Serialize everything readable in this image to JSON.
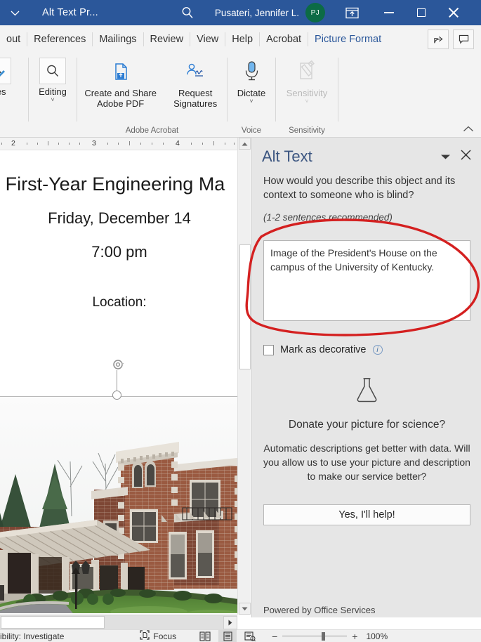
{
  "titlebar": {
    "autosave_caret": "chevron-down",
    "document_title": "Alt Text Pr...",
    "search_icon": "search-icon",
    "user_name": "Pusateri, Jennifer L.",
    "avatar_initials": "PJ",
    "avatar_color": "#0c6b45",
    "ribbon_display_icon": "ribbon-display-options-icon",
    "minimize_label": "Minimize",
    "maximize_label": "Restore Down",
    "close_label": "Close",
    "background": "#2b579a"
  },
  "tabs": [
    {
      "label": "out",
      "active": false
    },
    {
      "label": "References",
      "active": false
    },
    {
      "label": "Mailings",
      "active": false
    },
    {
      "label": "Review",
      "active": false
    },
    {
      "label": "View",
      "active": false
    },
    {
      "label": "Help",
      "active": false
    },
    {
      "label": "Acrobat",
      "active": false
    },
    {
      "label": "Picture Format",
      "active": true
    }
  ],
  "tab_actions": {
    "share_label": "Share",
    "comments_label": "Comments"
  },
  "ribbon": {
    "collapse_icon": "chevron-up-icon",
    "groups": [
      {
        "name": "styles",
        "label": "",
        "buttons": [
          {
            "icon": "styles-icon",
            "label": "yles",
            "caret": "ⱽ",
            "disabled": false
          }
        ]
      },
      {
        "name": "editing",
        "label": "",
        "buttons": [
          {
            "icon": "search-icon",
            "label": "Editing",
            "caret": "ⱽ",
            "disabled": false
          }
        ]
      },
      {
        "name": "adobe-acrobat",
        "label": "Adobe Acrobat",
        "buttons": [
          {
            "icon": "create-share-pdf-icon",
            "label": "Create and Share\nAdobe PDF",
            "caret": "",
            "disabled": false
          },
          {
            "icon": "request-signatures-icon",
            "label": "Request\nSignatures",
            "caret": "",
            "disabled": false
          }
        ]
      },
      {
        "name": "voice",
        "label": "Voice",
        "buttons": [
          {
            "icon": "microphone-icon",
            "label": "Dictate",
            "caret": "ⱽ",
            "disabled": false
          }
        ]
      },
      {
        "name": "sensitivity",
        "label": "Sensitivity",
        "buttons": [
          {
            "icon": "sensitivity-label-icon",
            "label": "Sensitivity",
            "caret": "ⱽ",
            "disabled": true
          }
        ]
      }
    ]
  },
  "ruler": {
    "marks": [
      "2",
      "3",
      "4"
    ]
  },
  "document": {
    "lines": [
      "First-Year Engineering Ma",
      "Friday, December 14",
      "7:00 pm",
      "Location:"
    ],
    "image_alt": "Image of the President's House on the campus of the University of Kentucky.",
    "image_selected": true,
    "rotate_handle": "rotate-handle-icon"
  },
  "pane": {
    "title": "Alt Text",
    "caret_icon": "chevron-down-icon",
    "close_icon": "close-icon",
    "prompt": "How would you describe this object and its context to someone who is blind?",
    "hint": "(1-2 sentences recommended)",
    "alt_text_value": "Image of the President's House on the campus of the University of Kentucky.",
    "alt_text_placeholder": "",
    "decorative_label": "Mark as decorative",
    "decorative_checked": false,
    "info_icon": "info-icon",
    "flask_icon": "flask-icon",
    "donate_title": "Donate your picture for science?",
    "donate_body": "Automatic descriptions get better with data. Will you allow us to use your picture and description to make our service better?",
    "help_button": "Yes, I'll help!",
    "footer": "Powered by Office Services"
  },
  "statusbar": {
    "accessibility_text": "ibility: Investigate",
    "focus_label": "Focus",
    "focus_icon": "focus-icon",
    "view_read_icon": "read-mode-icon",
    "view_print_icon": "print-layout-icon",
    "view_web_icon": "web-layout-icon",
    "zoom_out_label": "−",
    "zoom_in_label": "+",
    "zoom_percent": "100%"
  },
  "annotation": {
    "color": "#d42020",
    "shape": "hand-drawn-ellipse",
    "target": "alt-text-box"
  }
}
